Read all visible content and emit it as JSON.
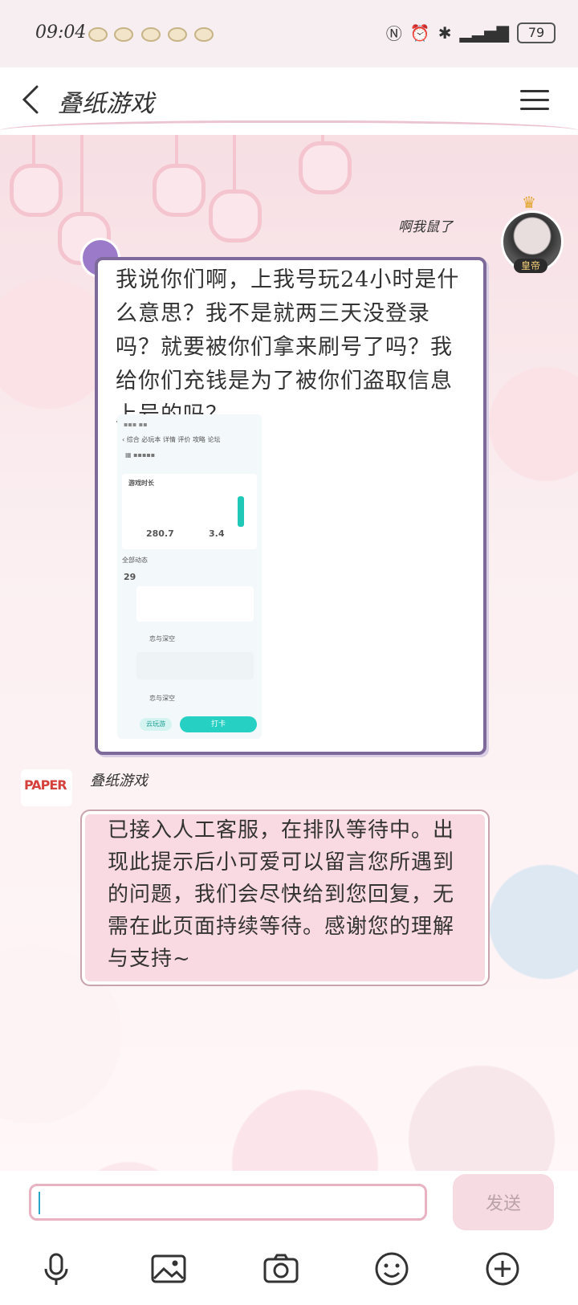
{
  "status_bar": {
    "time": "09:04",
    "battery": "79"
  },
  "header": {
    "title": "叠纸游戏"
  },
  "messages": {
    "user": {
      "name": "啊我鼠了",
      "badge": "皇帝",
      "text": "我说你们啊，上我号玩24小时是什么意思？我不是就两三天没登录吗？就要被你们拿来刷号了吗？我给你们充钱是为了被你们盗取信息上号的吗？"
    },
    "bot": {
      "name": "叠纸游戏",
      "text": "已接入人工客服，在排队等待中。出现此提示后小可爱可以留言您所遇到的问题，我们会尽快给到您回复，无需在此页面持续等待。感谢您的理解与支持~"
    }
  },
  "attached_screenshot": {
    "tabs": [
      "综合",
      "必玩本",
      "详情",
      "评价",
      "攻略",
      "论坛"
    ],
    "section_title": "游戏时长",
    "total_hours": "280.7",
    "recent_hours": "3.4",
    "filter_label": "全部动态",
    "date_day": "29",
    "entries": [
      "恋与深空",
      "恋与深空"
    ],
    "button_label": "打卡",
    "chip_label": "云玩游"
  },
  "input": {
    "placeholder": "",
    "send_label": "发送"
  },
  "toolbar": {
    "icons": [
      "microphone-icon",
      "image-icon",
      "camera-icon",
      "emoji-icon",
      "plus-icon"
    ]
  },
  "colors": {
    "bubble_border": "#7e6a9a",
    "bot_bubble": "#f9d9e2",
    "send_button": "#f6dbe2",
    "accent": "#26d0c2"
  }
}
